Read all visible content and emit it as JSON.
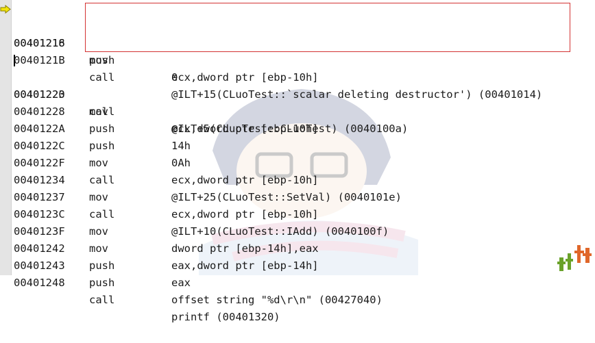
{
  "window": "disassembly-view",
  "current_row_index": 0,
  "highlight_rows": [
    0,
    1,
    2
  ],
  "colors": {
    "highlight_border": "#d33131",
    "arrow_fill": "#f2e40c",
    "gutter": "#e4e4e4"
  },
  "icons": {
    "instruction_pointer": "yellow-arrow-icon"
  },
  "rows": [
    {
      "addr": "00401216",
      "op": "push",
      "arg": "0"
    },
    {
      "addr": "00401218",
      "op": "mov",
      "arg": "ecx,dword ptr [ebp-10h]"
    },
    {
      "addr": "0040121B",
      "op": "call",
      "arg": "@ILT+15(CLuoTest::`scalar deleting destructor') (00401014)"
    },
    {
      "addr": "00401220",
      "op": "mov",
      "arg": "ecx,dword ptr [ebp-10h]"
    },
    {
      "addr": "00401223",
      "op": "call",
      "arg": "@ILT+5(CLuoTest::CLuoTest) (0040100a)"
    },
    {
      "addr": "00401228",
      "op": "push",
      "arg": "14h"
    },
    {
      "addr": "0040122A",
      "op": "push",
      "arg": "0Ah"
    },
    {
      "addr": "0040122C",
      "op": "mov",
      "arg": "ecx,dword ptr [ebp-10h]"
    },
    {
      "addr": "0040122F",
      "op": "call",
      "arg": "@ILT+25(CLuoTest::SetVal) (0040101e)"
    },
    {
      "addr": "00401234",
      "op": "mov",
      "arg": "ecx,dword ptr [ebp-10h]"
    },
    {
      "addr": "00401237",
      "op": "call",
      "arg": "@ILT+10(CLuoTest::IAdd) (0040100f)"
    },
    {
      "addr": "0040123C",
      "op": "mov",
      "arg": "dword ptr [ebp-14h],eax"
    },
    {
      "addr": "0040123F",
      "op": "mov",
      "arg": "eax,dword ptr [ebp-14h]"
    },
    {
      "addr": "00401242",
      "op": "push",
      "arg": "eax"
    },
    {
      "addr": "00401243",
      "op": "push",
      "arg": "offset string \"%d\\r\\n\" (00427040)"
    },
    {
      "addr": "00401248",
      "op": "call",
      "arg": "printf (00401320)"
    }
  ]
}
